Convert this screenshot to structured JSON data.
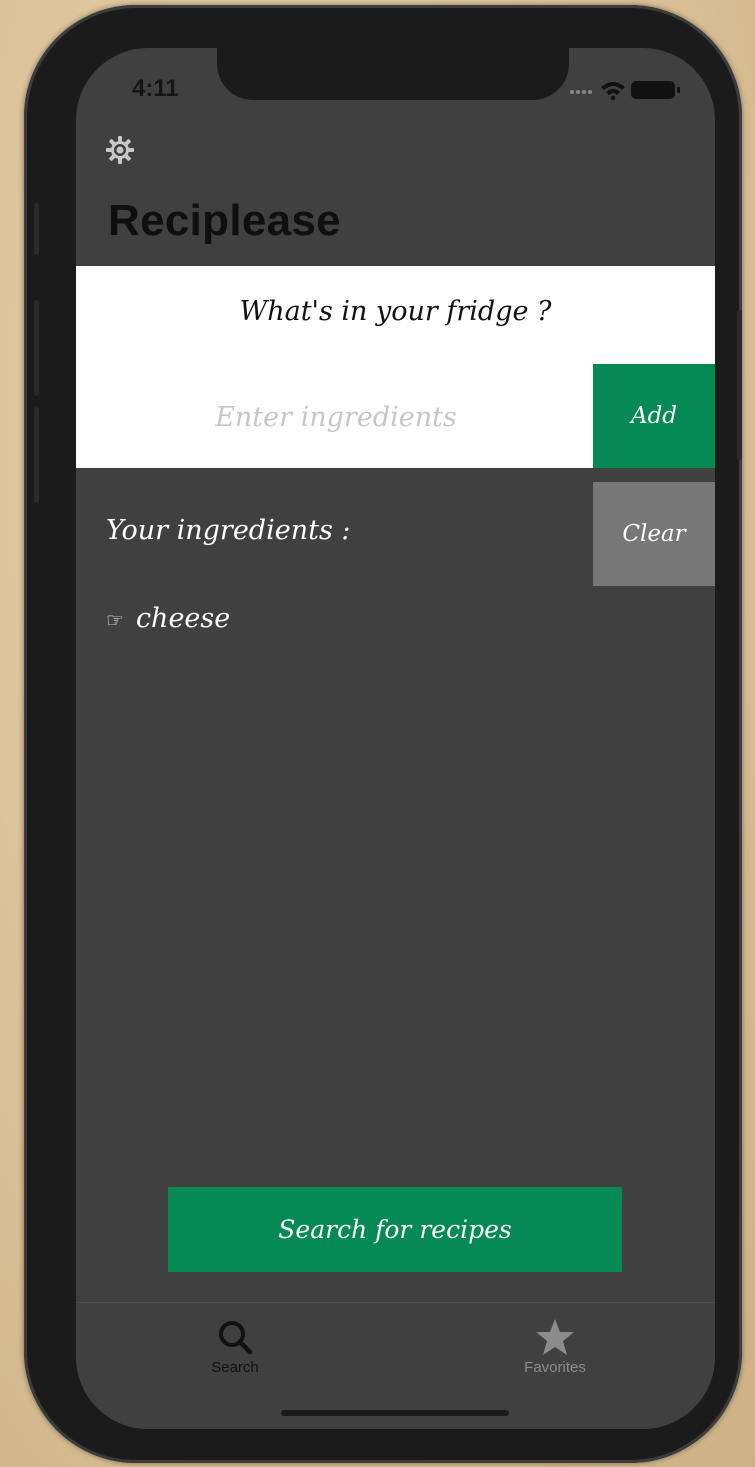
{
  "status_bar": {
    "time": "4:11"
  },
  "header": {
    "title": "Reciplease",
    "settings_icon": "gear-icon"
  },
  "fridge": {
    "heading": "What's in your fridge ?",
    "input_value": "",
    "input_placeholder": "Enter ingredients",
    "add_label": "Add"
  },
  "ingredients": {
    "heading": "Your ingredients :",
    "clear_label": "Clear",
    "bullet_icon": "pointing-hand-icon",
    "bullet": "☞",
    "items": [
      "cheese"
    ]
  },
  "search_button": {
    "label": "Search for recipes"
  },
  "tab_bar": {
    "tabs": [
      {
        "label": "Search",
        "icon": "search-icon",
        "selected": true
      },
      {
        "label": "Favorites",
        "icon": "star-icon",
        "selected": false
      }
    ]
  },
  "colors": {
    "accent_green": "#058a53",
    "clear_gray": "#777777",
    "background": "#404040"
  }
}
